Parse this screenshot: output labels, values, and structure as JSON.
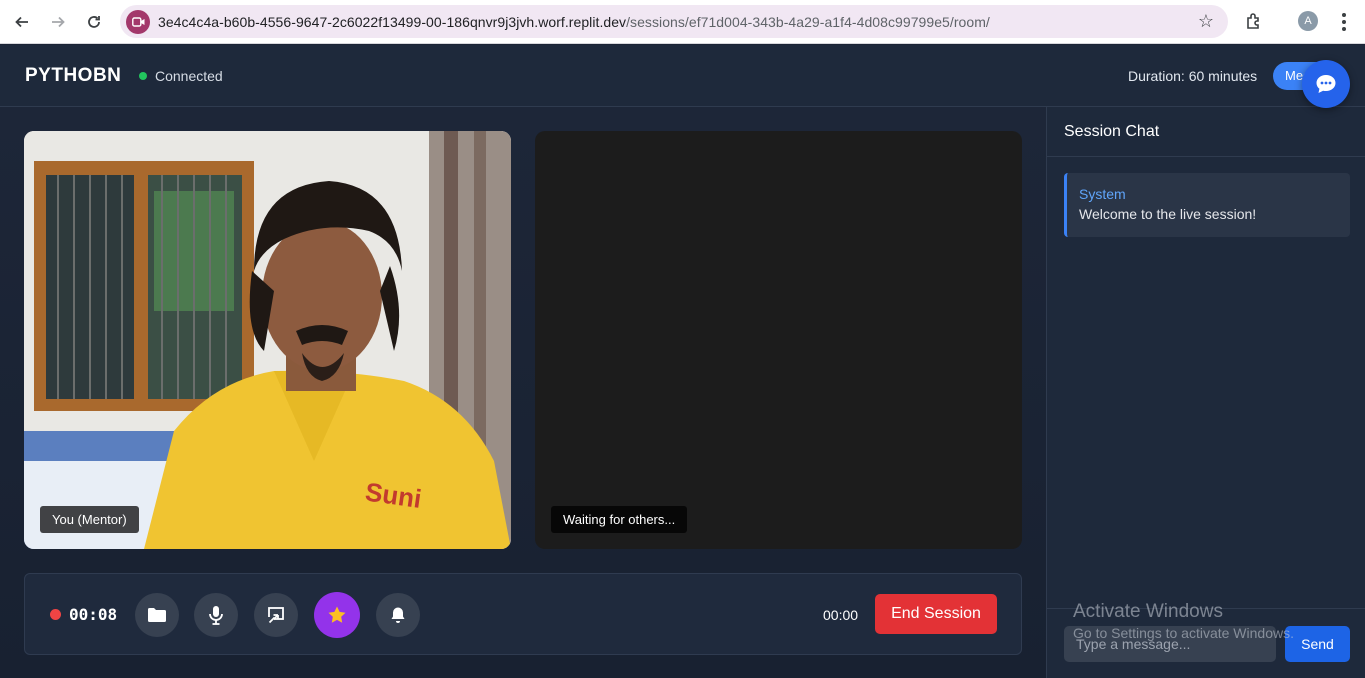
{
  "browser": {
    "url_host": "3e4c4c4a-b60b-4556-9647-2c6022f13499-00-186qnvr9j3jvh.worf.replit.dev",
    "url_path": "/sessions/ef71d004-343b-4a29-a1f4-4d08c99799e5/room/",
    "profile_initial": "A"
  },
  "header": {
    "brand": "PYTHOBN",
    "status": "Connected",
    "duration": "Duration: 60 minutes",
    "meet_label": "Meet"
  },
  "videos": {
    "local_label": "You (Mentor)",
    "remote_label": "Waiting for others..."
  },
  "controls": {
    "recording_time": "00:08",
    "session_timer": "00:00",
    "end_label": "End Session",
    "buttons": [
      "folder-icon",
      "microphone-icon",
      "screen-share-icon",
      "star-icon",
      "bell-icon"
    ]
  },
  "chat": {
    "title": "Session Chat",
    "messages": [
      {
        "sender": "System",
        "text": "Welcome to the live session!"
      }
    ],
    "input_placeholder": "Type a message...",
    "send_label": "Send"
  },
  "watermark": {
    "title": "Activate Windows",
    "subtitle": "Go to Settings to activate Windows."
  },
  "colors": {
    "accent": "#3b82f6",
    "danger": "#e33236",
    "status_ok": "#22c55e",
    "active_control": "#9333ea"
  }
}
